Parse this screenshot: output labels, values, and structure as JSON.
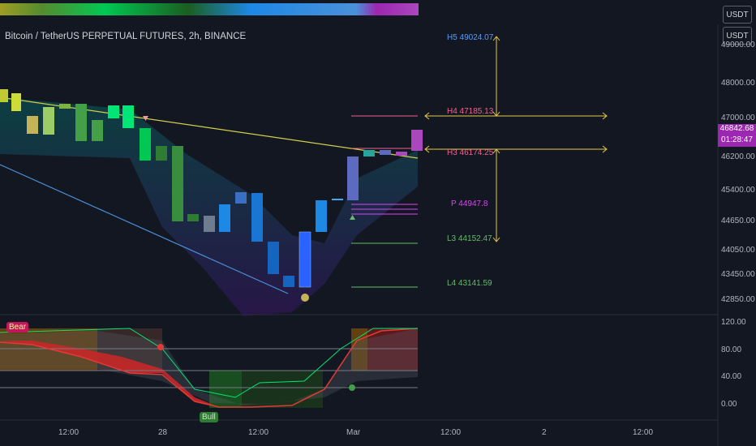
{
  "header": {
    "title": "Bitcoin / TetherUS PERPETUAL FUTURES, 2h, BINANCE",
    "currency_top": "USDT",
    "currency_main": "USDT"
  },
  "price_axis": {
    "ticks": [
      "49000.00",
      "48000.00",
      "47000.00",
      "46200.00",
      "45400.00",
      "44650.00",
      "44050.00",
      "43450.00",
      "42850.00"
    ]
  },
  "last_price": {
    "value": "46842.68",
    "countdown": "01:28:47",
    "color": "#9c27b0"
  },
  "pivots": [
    {
      "label": "H5 49024.07",
      "color": "#5b9cf6"
    },
    {
      "label": "H4 47185.13",
      "color": "#f06292"
    },
    {
      "label": "H3 46174.25",
      "color": "#f06292"
    },
    {
      "label": "P 44947.8",
      "color": "#e040fb"
    },
    {
      "label": "L3 44152.47",
      "color": "#66bb6a"
    },
    {
      "label": "L4 43141.59",
      "color": "#66bb6a"
    }
  ],
  "oscillator": {
    "ticks": [
      "120.00",
      "80.00",
      "40.00",
      "0.00"
    ],
    "bear_label": "Bear",
    "bull_label": "Bull"
  },
  "time_axis": {
    "ticks": [
      "12:00",
      "28",
      "12:00",
      "Mar",
      "12:00",
      "2",
      "12:00"
    ]
  },
  "colors": {
    "background": "#131722",
    "bull_candle": "#2962ff",
    "bear_candle": "#c62828",
    "trend_line": "#d4d04a",
    "channel_line": "#4a90d9"
  }
}
